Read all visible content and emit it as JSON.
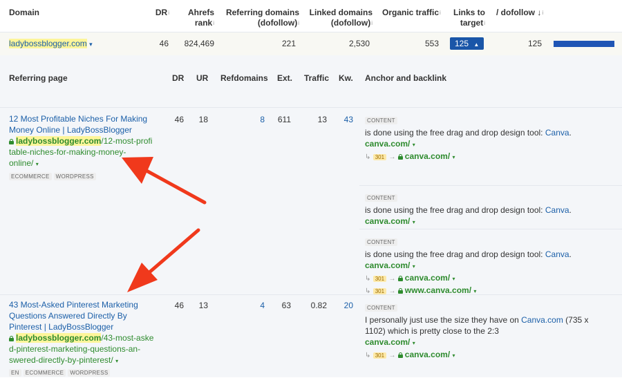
{
  "domain_table": {
    "headers": {
      "domain": "Domain",
      "dr": "DR",
      "ahrefs_rank_1": "Ahrefs",
      "ahrefs_rank_2": "rank",
      "ref_domains_1": "Referring domains",
      "ref_domains_2": "(dofollow)",
      "linked_domains_1": "Linked domains",
      "linked_domains_2": "(dofollow)",
      "organic_traffic": "Organic traffic",
      "links_target_1": "Links to",
      "links_target_2": "target",
      "dofollow": "/ dofollow",
      "info_mark": "i",
      "sort_arrow": "↓"
    },
    "row": {
      "domain": "ladybossblogger.com",
      "dr": "46",
      "ahrefs_rank": "824,469",
      "ref_domains": "221",
      "linked_domains": "2,530",
      "organic_traffic": "553",
      "links_to_target": "125",
      "dofollow": "125",
      "dofollow_fraction": 1.0
    }
  },
  "backlinks_table": {
    "headers": {
      "referring_page": "Referring page",
      "dr": "DR",
      "ur": "UR",
      "refdomains": "Refdomains",
      "ext": "Ext.",
      "traffic": "Traffic",
      "kw": "Kw.",
      "anchor": "Anchor and backlink"
    },
    "rows": [
      {
        "title_1": "12 Most Profitable Niches For Making",
        "title_2": "Money Online | LadyBossBlogger",
        "url_domain": "ladybossblogger.com",
        "url_path_1": "/12-most-profi",
        "url_path_2": "table-niches-for-making-money-",
        "url_path_3": "online/",
        "tags": [
          "ECOMMERCE",
          "WORDPRESS"
        ],
        "dr": "46",
        "ur": "18",
        "refdomains": "8",
        "ext": "611",
        "traffic": "13",
        "kw": "43"
      },
      {
        "title_1": "43 Most-Asked Pinterest Marketing",
        "title_2": "Questions Answered Directly By",
        "title_3": "Pinterest | LadyBossBlogger",
        "url_domain": "ladybossblogger.com",
        "url_path_1": "/43-most-aske",
        "url_path_2": "d-pinterest-marketing-questions-an-",
        "url_path_3": "swered-directly-by-pinterest/",
        "tags": [
          "EN",
          "ECOMMERCE",
          "WORDPRESS"
        ],
        "dr": "46",
        "ur": "13",
        "refdomains": "4",
        "ext": "63",
        "traffic": "0.82",
        "kw": "20"
      }
    ],
    "anchors": [
      {
        "label": "CONTENT",
        "text": "is done using the free drag and drop design tool: ",
        "anchor": "Canva",
        "tail": ".",
        "target": "canva.com/",
        "redirects": [
          {
            "code": "301",
            "url": "canva.com/"
          }
        ]
      },
      {
        "label": "CONTENT",
        "text": "is done using the free drag and drop design tool: ",
        "anchor": "Canva",
        "tail": ".",
        "target": "canva.com/"
      },
      {
        "label": "CONTENT",
        "text": "is done using the free drag and drop design tool: ",
        "anchor": "Canva",
        "tail": ".",
        "target": "canva.com/",
        "redirects": [
          {
            "code": "301",
            "url": "canva.com/"
          },
          {
            "code": "301",
            "url": "www.canva.com/"
          }
        ]
      },
      {
        "label": "CONTENT",
        "text_1": "I personally just use the size they have on ",
        "anchor": "Canva.com",
        "text_2": " (735 x",
        "text_3": "1102) which is pretty close to the 2:3",
        "target": "canva.com/",
        "redirects": [
          {
            "code": "301",
            "url": "canva.com/"
          }
        ]
      }
    ]
  },
  "symbols": {
    "caret_down": "▾",
    "caret_up": "▲",
    "redirect_hook": "↳",
    "arrow": "→"
  },
  "colors": {
    "link": "#1b5fa8",
    "url_green": "#2e8b2e",
    "highlight": "#fdf59a",
    "badge_blue": "#1a56a8",
    "annotation_arrow": "#f0391c"
  }
}
